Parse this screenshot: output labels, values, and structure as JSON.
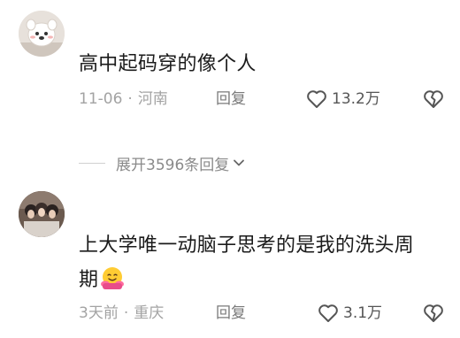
{
  "comments": [
    {
      "text": "高中起码穿的像个人",
      "date": "11-06",
      "location": "河南",
      "reply_label": "回复",
      "likes": "13.2万",
      "avatar_icon": "avatar-cartoon-icon"
    },
    {
      "text": "上大学唯一动脑子思考的是我的洗头周期",
      "date": "3天前",
      "location": "重庆",
      "reply_label": "回复",
      "likes": "3.1万",
      "avatar_icon": "avatar-photo-icon",
      "emoji": "hugging-face-emoji"
    }
  ],
  "expand_replies": {
    "label": "展开3596条回复"
  },
  "colors": {
    "meta": "#a3a3a3",
    "text": "#1b1b1b",
    "icon": "#555555"
  }
}
